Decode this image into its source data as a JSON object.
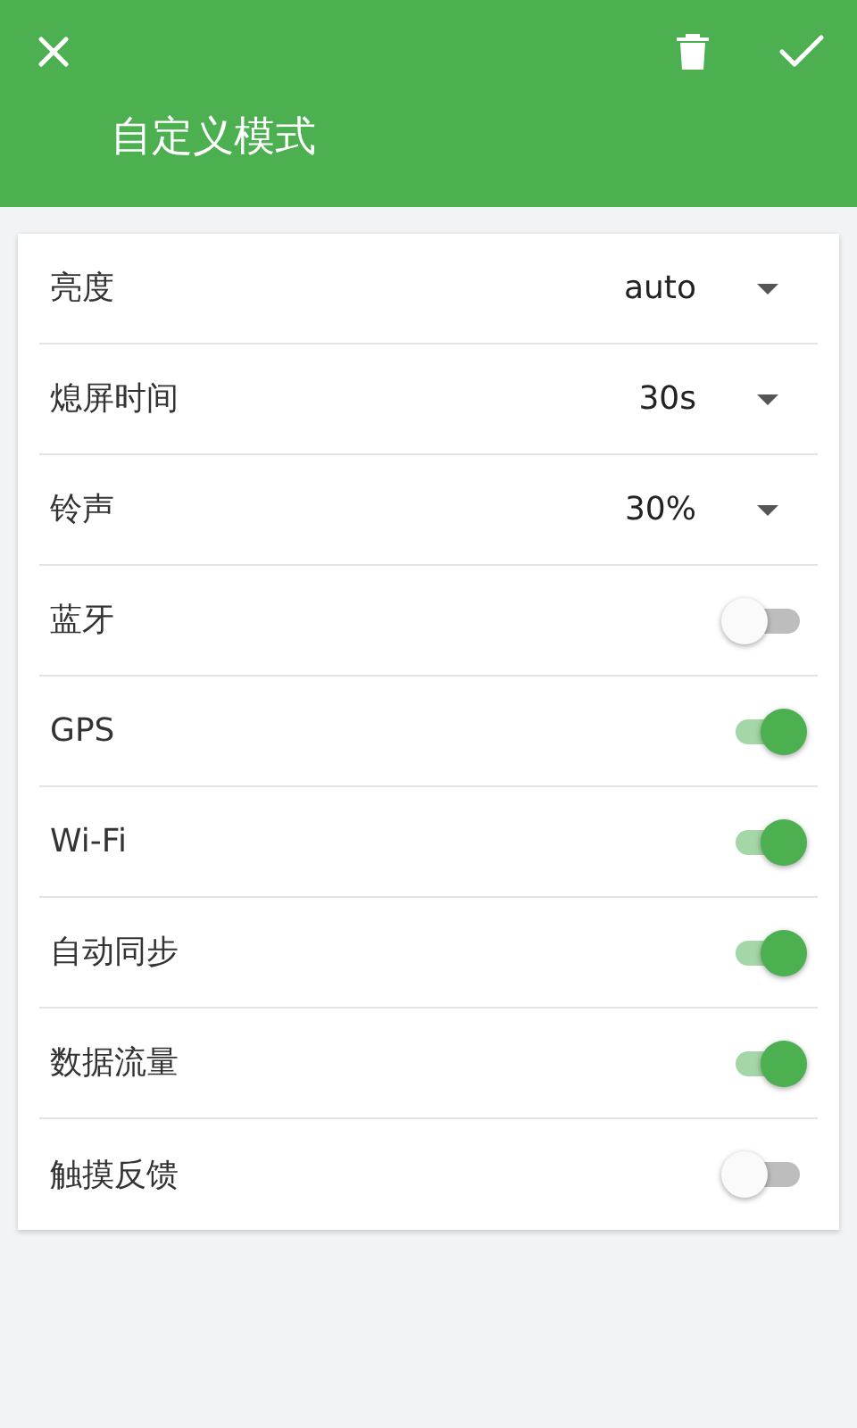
{
  "header": {
    "title": "自定义模式"
  },
  "settings": [
    {
      "kind": "dropdown",
      "label": "亮度",
      "value": "auto"
    },
    {
      "kind": "dropdown",
      "label": "熄屏时间",
      "value": "30s"
    },
    {
      "kind": "dropdown",
      "label": "铃声",
      "value": "30%"
    },
    {
      "kind": "toggle",
      "label": "蓝牙",
      "on": false
    },
    {
      "kind": "toggle",
      "label": "GPS",
      "on": true
    },
    {
      "kind": "toggle",
      "label": "Wi-Fi",
      "on": true
    },
    {
      "kind": "toggle",
      "label": "自动同步",
      "on": true
    },
    {
      "kind": "toggle",
      "label": "数据流量",
      "on": true
    },
    {
      "kind": "toggle",
      "label": "触摸反馈",
      "on": false
    }
  ]
}
